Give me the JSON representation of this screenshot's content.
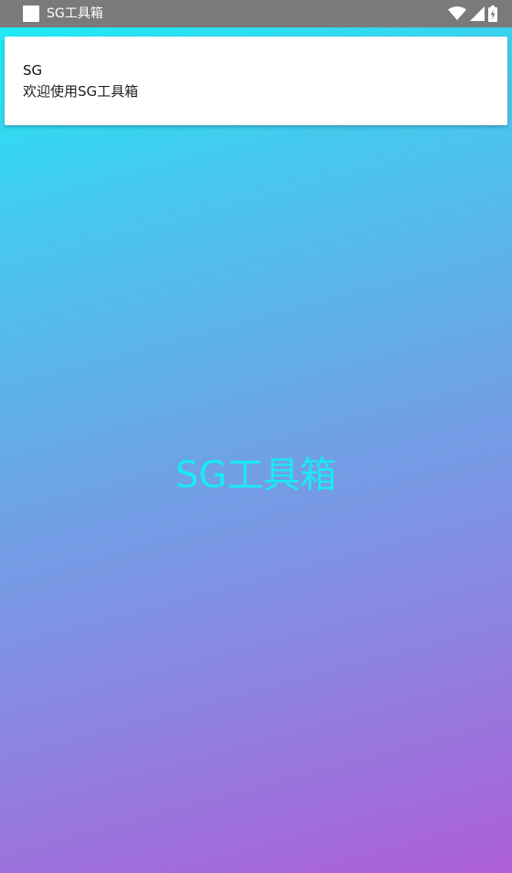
{
  "status_bar": {
    "app_title": "SG工具箱",
    "icons": [
      "app-notification-icon",
      "wifi-icon",
      "cell-signal-icon",
      "battery-charging-icon"
    ]
  },
  "notification": {
    "title": "SG",
    "text": "欢迎使用SG工具箱"
  },
  "splash": {
    "title": "SG工具箱"
  },
  "colors": {
    "gradient_top": "#18f0f7",
    "gradient_bottom": "#ad5ed8",
    "splash_text": "#1ae9f6",
    "status_bar_bg": "#7a7a7a"
  }
}
